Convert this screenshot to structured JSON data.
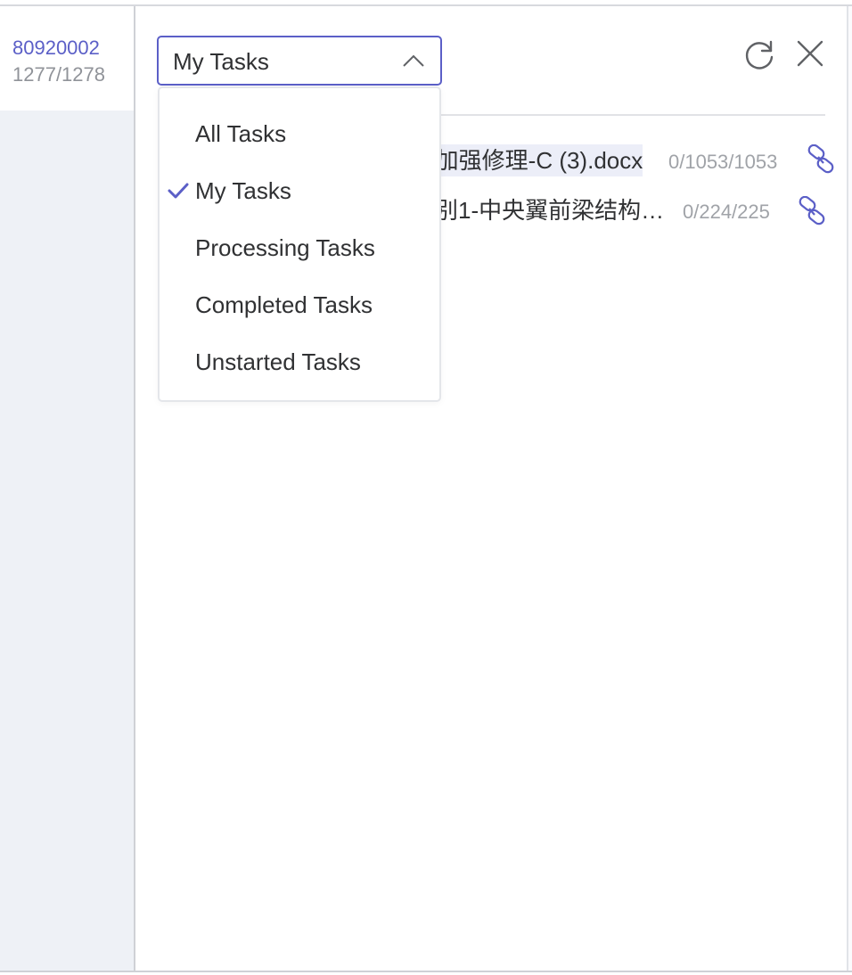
{
  "left_panel": {
    "item": {
      "id": "80920002",
      "count": "1277/1278"
    }
  },
  "filter": {
    "selected": "My Tasks",
    "options": [
      {
        "label": "All Tasks",
        "checked": false
      },
      {
        "label": "My Tasks",
        "checked": true
      },
      {
        "label": "Processing Tasks",
        "checked": false
      },
      {
        "label": "Completed Tasks",
        "checked": false
      },
      {
        "label": "Unstarted Tasks",
        "checked": false
      }
    ]
  },
  "header_icons": {
    "refresh": "refresh-icon",
    "close": "close-icon"
  },
  "tasks": [
    {
      "name": "-加强修理-C (3).docx",
      "count": "0/1053/1053",
      "icon": "link-icon"
    },
    {
      "name": "别1-中央翼前梁结构…",
      "count": "0/224/225",
      "icon": "link-icon"
    }
  ],
  "colors": {
    "accent": "#5b5fc7",
    "text": "#303133",
    "muted": "#909399",
    "sidebar_bg": "#eef1f6"
  }
}
